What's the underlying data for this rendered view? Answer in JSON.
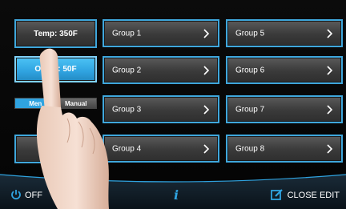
{
  "left_controls": {
    "temp_label": "Temp: 350F",
    "offset_label": "Offset: 50F",
    "mode_toggle": {
      "options": [
        "Menu",
        "Manual"
      ],
      "selected": "Menu",
      "visible_text_left": "Men"
    }
  },
  "groups": [
    {
      "label": "Group 1"
    },
    {
      "label": "Group 2"
    },
    {
      "label": "Group 3"
    },
    {
      "label": "Group 4"
    },
    {
      "label": "Group 5"
    },
    {
      "label": "Group 6"
    },
    {
      "label": "Group 7"
    },
    {
      "label": "Group 8"
    }
  ],
  "bottom_bar": {
    "off_label": "OFF",
    "info_icon": "info-icon",
    "close_edit_label": "CLOSE EDIT"
  },
  "colors": {
    "accent": "#2fa3e0",
    "button_border": "#3fa7dc",
    "background": "#050505"
  }
}
